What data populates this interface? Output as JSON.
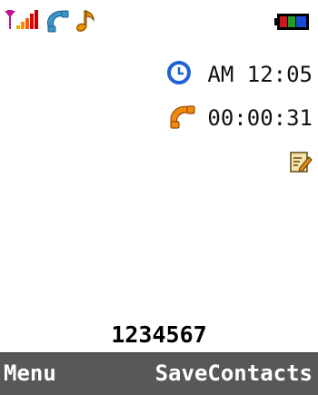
{
  "status_bar": {
    "icons": [
      "signal-strength-icon",
      "call-status-icon",
      "music-note-icon",
      "battery-icon"
    ]
  },
  "call_info": {
    "time_icon": "clock-icon",
    "time": "AM 12:05",
    "duration_icon": "phone-handset-icon",
    "duration": "00:00:31",
    "memo_icon": "memo-edit-icon"
  },
  "dialed_number": "1234567",
  "softkeys": {
    "left": "Menu",
    "right": "SaveContacts"
  },
  "colors": {
    "softkey_bar": "#585858",
    "clock_blue": "#1e63d6",
    "handset_orange": "#f08a0c",
    "battery_green": "#1f9f28",
    "signal_magenta": "#c2128b"
  }
}
